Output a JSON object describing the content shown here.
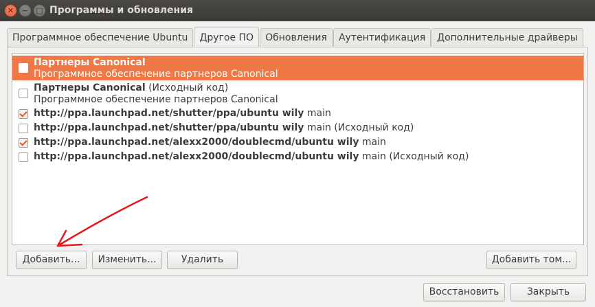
{
  "window": {
    "title": "Программы и обновления",
    "close_glyph": "✕",
    "minimize_glyph": "−",
    "maximize_glyph": "□"
  },
  "tabs": [
    {
      "label": "Программное обеспечение Ubuntu",
      "active": false
    },
    {
      "label": "Другое ПО",
      "active": true
    },
    {
      "label": "Обновления",
      "active": false
    },
    {
      "label": "Аутентификация",
      "active": false
    },
    {
      "label": "Дополнительные драйверы",
      "active": false
    }
  ],
  "sources": [
    {
      "checked": false,
      "selected": true,
      "bold": "Партнеры Canonical",
      "normal": "",
      "subtitle": "Программное обеспечение партнеров Canonical"
    },
    {
      "checked": false,
      "selected": false,
      "bold": "Партнеры Canonical",
      "normal": " (Исходный код)",
      "subtitle": "Программное обеспечение партнеров Canonical"
    },
    {
      "checked": true,
      "selected": false,
      "bold": "http://ppa.launchpad.net/shutter/ppa/ubuntu wily",
      "normal": " main",
      "subtitle": ""
    },
    {
      "checked": false,
      "selected": false,
      "bold": "http://ppa.launchpad.net/shutter/ppa/ubuntu wily",
      "normal": " main (Исходный код)",
      "subtitle": ""
    },
    {
      "checked": true,
      "selected": false,
      "bold": "http://ppa.launchpad.net/alexx2000/doublecmd/ubuntu wily",
      "normal": " main",
      "subtitle": ""
    },
    {
      "checked": false,
      "selected": false,
      "bold": "http://ppa.launchpad.net/alexx2000/doublecmd/ubuntu wily",
      "normal": " main (Исходный код)",
      "subtitle": ""
    }
  ],
  "buttons": {
    "add": "Добавить...",
    "edit": "Изменить...",
    "remove": "Удалить",
    "add_volume": "Добавить том...",
    "revert": "Восстановить",
    "close": "Закрыть"
  },
  "colors": {
    "selection": "#f07746",
    "annotation_arrow": "#e8161b"
  }
}
